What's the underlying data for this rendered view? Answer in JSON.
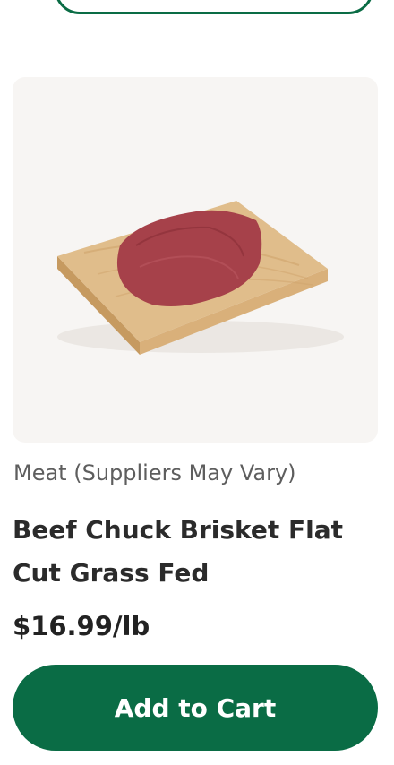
{
  "product": {
    "category": "Meat (Suppliers May Vary)",
    "title": "Beef Chuck Brisket Flat Cut Grass Fed",
    "price": "$16.99/lb"
  },
  "actions": {
    "add_to_cart_label": "Add to Cart"
  },
  "colors": {
    "brand_green": "#0a6c45",
    "image_background": "#f7f5f3"
  }
}
